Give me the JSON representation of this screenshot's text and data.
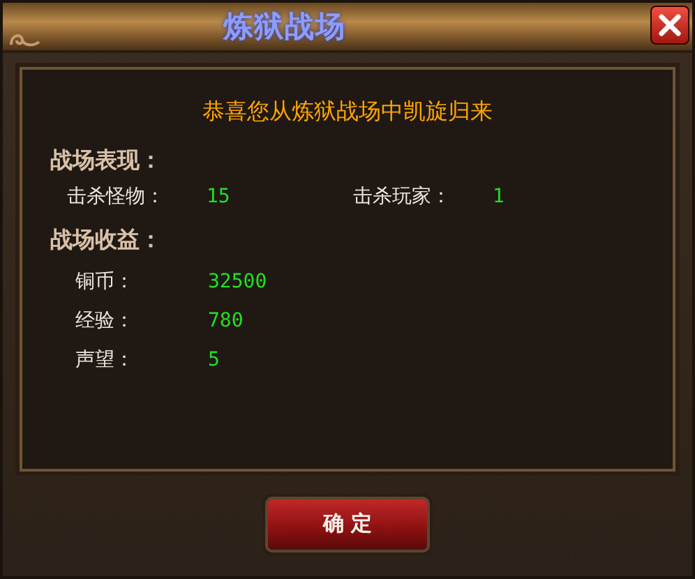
{
  "window": {
    "title": "炼狱战场"
  },
  "message": "恭喜您从炼狱战场中凯旋归来",
  "sections": [
    {
      "title": "战场表现：",
      "kind": "inline",
      "stats": [
        {
          "label": "击杀怪物：",
          "value": "15"
        },
        {
          "label": "击杀玩家：",
          "value": "1"
        }
      ]
    },
    {
      "title": "战场收益：",
      "kind": "list",
      "stats": [
        {
          "label": "铜币：",
          "value": "32500"
        },
        {
          "label": "经验：",
          "value": "780"
        },
        {
          "label": "声望：",
          "value": "5"
        }
      ]
    }
  ],
  "buttons": [
    "确 定"
  ]
}
